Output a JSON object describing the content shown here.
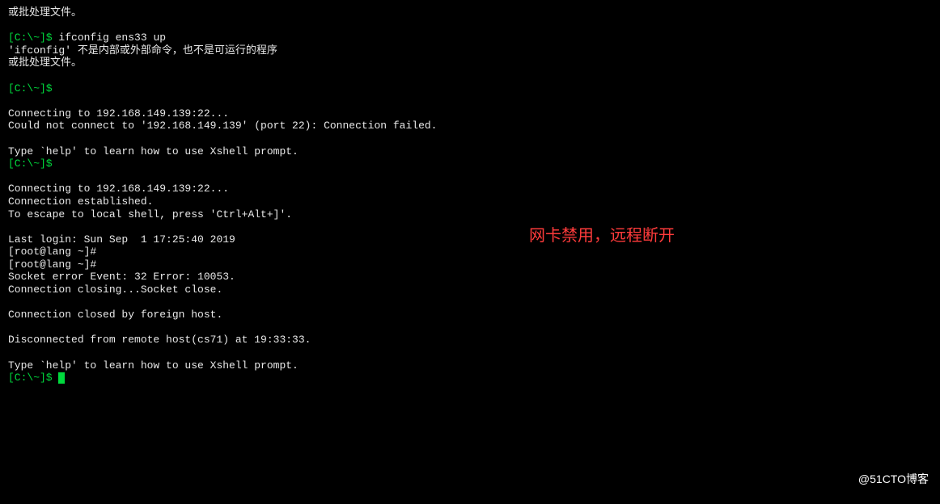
{
  "terminal": {
    "lines": [
      {
        "segs": [
          {
            "t": "或批处理文件。",
            "c": "white-text"
          }
        ]
      },
      {
        "segs": []
      },
      {
        "segs": [
          {
            "t": "[C:\\~]$ ",
            "c": "prompt-green"
          },
          {
            "t": "ifconfig ens33 up",
            "c": "white-text"
          }
        ]
      },
      {
        "segs": [
          {
            "t": "'ifconfig' 不是内部或外部命令，也不是可运行的程序",
            "c": "white-text"
          }
        ]
      },
      {
        "segs": [
          {
            "t": "或批处理文件。",
            "c": "white-text"
          }
        ]
      },
      {
        "segs": []
      },
      {
        "segs": [
          {
            "t": "[C:\\~]$ ",
            "c": "prompt-green"
          }
        ]
      },
      {
        "segs": []
      },
      {
        "segs": [
          {
            "t": "Connecting to 192.168.149.139:22...",
            "c": "white-text"
          }
        ]
      },
      {
        "segs": [
          {
            "t": "Could not connect to '192.168.149.139' (port 22): Connection failed.",
            "c": "white-text"
          }
        ]
      },
      {
        "segs": []
      },
      {
        "segs": [
          {
            "t": "Type `help' to learn how to use Xshell prompt.",
            "c": "white-text"
          }
        ]
      },
      {
        "segs": [
          {
            "t": "[C:\\~]$ ",
            "c": "prompt-green"
          }
        ]
      },
      {
        "segs": []
      },
      {
        "segs": [
          {
            "t": "Connecting to 192.168.149.139:22...",
            "c": "white-text"
          }
        ]
      },
      {
        "segs": [
          {
            "t": "Connection established.",
            "c": "white-text"
          }
        ]
      },
      {
        "segs": [
          {
            "t": "To escape to local shell, press 'Ctrl+Alt+]'.",
            "c": "white-text"
          }
        ]
      },
      {
        "segs": []
      },
      {
        "segs": [
          {
            "t": "Last login: Sun Sep  1 17:25:40 2019",
            "c": "white-text"
          }
        ]
      },
      {
        "segs": [
          {
            "t": "[root@lang ~]#",
            "c": "white-text"
          }
        ]
      },
      {
        "segs": [
          {
            "t": "[root@lang ~]#",
            "c": "white-text"
          }
        ]
      },
      {
        "segs": [
          {
            "t": "Socket error Event: 32 Error: 10053.",
            "c": "white-text"
          }
        ]
      },
      {
        "segs": [
          {
            "t": "Connection closing...Socket close.",
            "c": "white-text"
          }
        ]
      },
      {
        "segs": []
      },
      {
        "segs": [
          {
            "t": "Connection closed by foreign host.",
            "c": "white-text"
          }
        ]
      },
      {
        "segs": []
      },
      {
        "segs": [
          {
            "t": "Disconnected from remote host(cs71) at 19:33:33.",
            "c": "white-text"
          }
        ]
      },
      {
        "segs": []
      },
      {
        "segs": [
          {
            "t": "Type `help' to learn how to use Xshell prompt.",
            "c": "white-text"
          }
        ]
      },
      {
        "segs": [
          {
            "t": "[C:\\~]$ ",
            "c": "prompt-green"
          }
        ],
        "cursor": true
      }
    ]
  },
  "annotation": {
    "text1": "网卡禁用，远程断开"
  },
  "watermark": "@51CTO博客"
}
